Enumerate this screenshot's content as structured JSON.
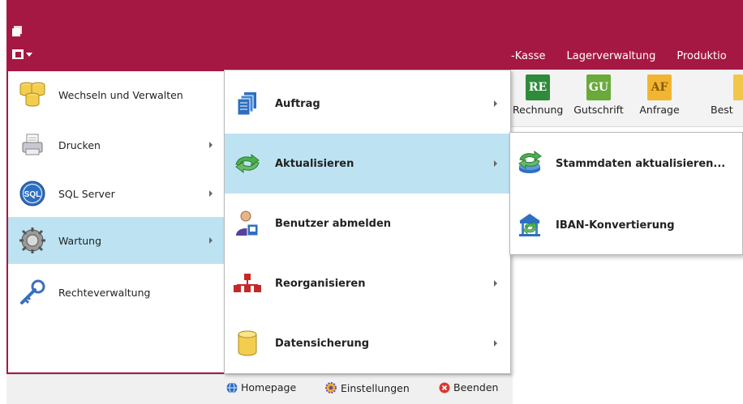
{
  "ribbon": {
    "tabs": [
      "-Kasse",
      "Lagerverwaltung",
      "Produktio"
    ],
    "buttons": [
      {
        "abbr": "RE",
        "label": "Rechnung",
        "color": "#2e8b3a"
      },
      {
        "abbr": "GU",
        "label": "Gutschrift",
        "color": "#6aaa3c"
      },
      {
        "abbr": "AF",
        "label": "Anfrage",
        "color": "#f2b531"
      },
      {
        "abbr": "",
        "label": "Best",
        "color": "#f2c64a"
      }
    ]
  },
  "main_menu": {
    "items": [
      {
        "label": "Wechseln und Verwalten",
        "icon": "database-stack-icon"
      },
      {
        "label": "Drucken",
        "icon": "printer-icon"
      },
      {
        "label": "SQL Server",
        "icon": "sql-icon"
      },
      {
        "label": "Wartung",
        "icon": "gear-icon"
      },
      {
        "label": "Rechteverwaltung",
        "icon": "key-icon"
      }
    ],
    "icon_sql_text": "SQL"
  },
  "submenu": {
    "items": [
      {
        "label": "Auftrag",
        "icon": "documents-icon"
      },
      {
        "label": "Aktualisieren",
        "icon": "refresh-arrows-icon"
      },
      {
        "label": "Benutzer abmelden",
        "icon": "user-logout-icon"
      },
      {
        "label": "Reorganisieren",
        "icon": "hierarchy-icon"
      },
      {
        "label": "Datensicherung",
        "icon": "database-icon"
      }
    ]
  },
  "flyout": {
    "items": [
      {
        "label": "Stammdaten aktualisieren...",
        "icon": "database-refresh-icon"
      },
      {
        "label": "IBAN-Konvertierung",
        "icon": "bank-refresh-icon"
      }
    ]
  },
  "bottom": {
    "homepage": "Homepage",
    "settings": "Einstellungen",
    "quit": "Beenden"
  },
  "colors": {
    "brand": "#a51843",
    "selection": "#bde3f3"
  }
}
